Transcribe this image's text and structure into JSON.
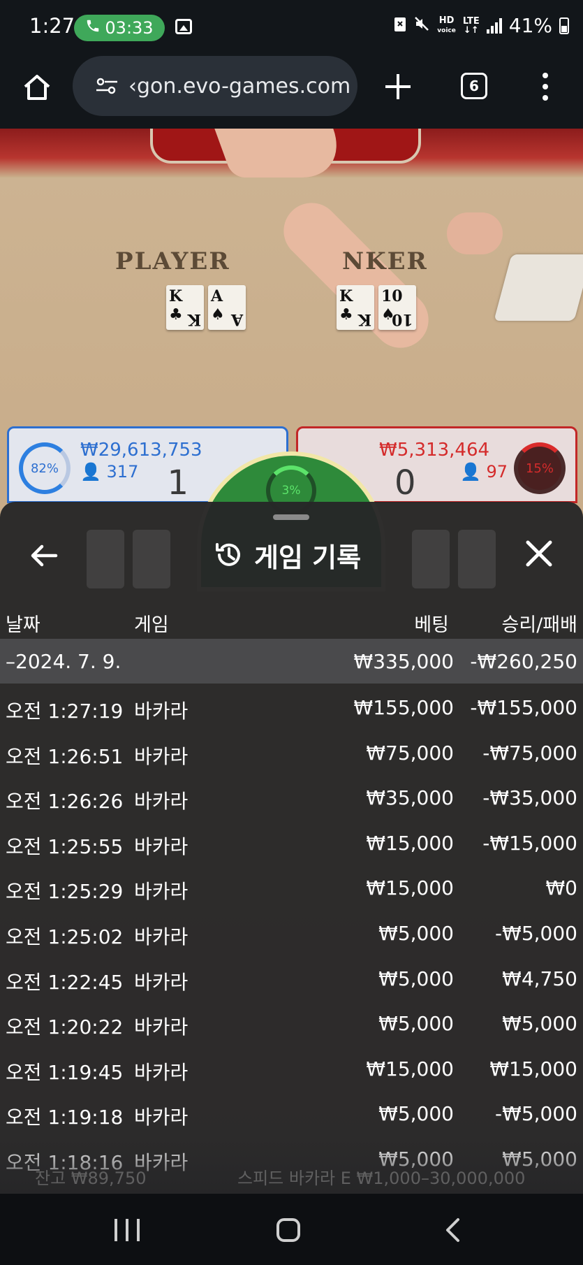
{
  "status_bar": {
    "time": "1:27",
    "call_duration": "03:33",
    "battery_percent": "41%",
    "network_label": "LTE",
    "hd_label": "HD",
    "voice_label": "voice"
  },
  "browser": {
    "url": "‹gon.evo-games.com",
    "tab_count": "6"
  },
  "game": {
    "player_label": "PLAYER",
    "banker_label": "NKER",
    "player_cards": [
      {
        "rank": "K",
        "suit": "♣"
      },
      {
        "rank": "A",
        "suit": "♠"
      }
    ],
    "banker_cards": [
      {
        "rank": "K",
        "suit": "♣"
      },
      {
        "rank": "10",
        "suit": "♠"
      }
    ],
    "player_panel": {
      "percent": "82%",
      "amount": "₩29,613,753",
      "players": "317",
      "score": "1"
    },
    "banker_panel": {
      "percent": "15%",
      "amount": "₩5,313,464",
      "players": "97",
      "score": "0"
    },
    "tie_percent": "3%",
    "accent_player": "#2d6fd0",
    "accent_banker": "#c22727",
    "accent_tie": "#2e8a3a"
  },
  "history": {
    "title": "게임 기록",
    "columns": {
      "date": "날짜",
      "game": "게임",
      "bet": "베팅",
      "result": "승리/패배"
    },
    "date_row": {
      "date": "–2024. 7. 9.",
      "bet": "₩335,000",
      "result": "-₩260,250"
    },
    "rows": [
      {
        "time": "오전 1:27:19",
        "game": "바카라",
        "bet": "₩155,000",
        "result": "-₩155,000"
      },
      {
        "time": "오전 1:26:51",
        "game": "바카라",
        "bet": "₩75,000",
        "result": "-₩75,000"
      },
      {
        "time": "오전 1:26:26",
        "game": "바카라",
        "bet": "₩35,000",
        "result": "-₩35,000"
      },
      {
        "time": "오전 1:25:55",
        "game": "바카라",
        "bet": "₩15,000",
        "result": "-₩15,000"
      },
      {
        "time": "오전 1:25:29",
        "game": "바카라",
        "bet": "₩15,000",
        "result": "₩0"
      },
      {
        "time": "오전 1:25:02",
        "game": "바카라",
        "bet": "₩5,000",
        "result": "-₩5,000"
      },
      {
        "time": "오전 1:22:45",
        "game": "바카라",
        "bet": "₩5,000",
        "result": "₩4,750"
      },
      {
        "time": "오전 1:20:22",
        "game": "바카라",
        "bet": "₩5,000",
        "result": "₩5,000"
      },
      {
        "time": "오전 1:19:45",
        "game": "바카라",
        "bet": "₩15,000",
        "result": "₩15,000"
      },
      {
        "time": "오전 1:19:18",
        "game": "바카라",
        "bet": "₩5,000",
        "result": "-₩5,000"
      },
      {
        "time": "오전 1:18:16",
        "game": "바카라",
        "bet": "₩5,000",
        "result": "₩5,000"
      }
    ],
    "footer": {
      "balance": "잔고 ₩89,750",
      "table": "스피드 바카라 E  ₩1,000–30,000,000"
    }
  }
}
